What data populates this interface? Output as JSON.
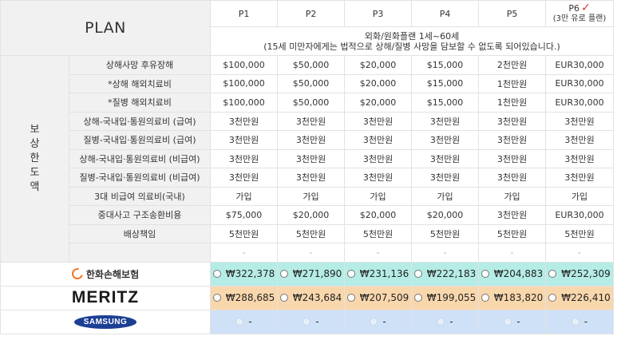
{
  "header": {
    "plan_label": "PLAN",
    "plans": [
      "P1",
      "P2",
      "P3",
      "P4",
      "P5",
      "P6"
    ],
    "p6_note": "(3만 유로 플랜)",
    "subheader_line1": "외화/원화플랜 1세~60세",
    "subheader_line2": "(15세 미만자에게는 법적으로 상해/질병 사망을 담보할 수 없도록 되어있습니다.)"
  },
  "coverage": {
    "label": "보\n상\n한\n도\n액",
    "rows": [
      {
        "name": "상해사망 후유장해",
        "values": [
          "$100,000",
          "$50,000",
          "$20,000",
          "$15,000",
          "2천만원",
          "EUR30,000"
        ]
      },
      {
        "name": "*상해 해외치료비",
        "values": [
          "$100,000",
          "$50,000",
          "$20,000",
          "$15,000",
          "1천만원",
          "EUR30,000"
        ]
      },
      {
        "name": "*질병 해외치료비",
        "values": [
          "$100,000",
          "$50,000",
          "$20,000",
          "$15,000",
          "1천만원",
          "EUR30,000"
        ]
      },
      {
        "name": "상해-국내입·통원의료비 (급여)",
        "values": [
          "3천만원",
          "3천만원",
          "3천만원",
          "3천만원",
          "3천만원",
          "3천만원"
        ]
      },
      {
        "name": "질병-국내입·통원의료비 (급여)",
        "values": [
          "3천만원",
          "3천만원",
          "3천만원",
          "3천만원",
          "3천만원",
          "3천만원"
        ]
      },
      {
        "name": "상해-국내입·통원의료비 (비급여)",
        "values": [
          "3천만원",
          "3천만원",
          "3천만원",
          "3천만원",
          "3천만원",
          "3천만원"
        ]
      },
      {
        "name": "질병-국내입·통원의료비 (비급여)",
        "values": [
          "3천만원",
          "3천만원",
          "3천만원",
          "3천만원",
          "3천만원",
          "3천만원"
        ]
      },
      {
        "name": "3대 비급여 의료비(국내)",
        "values": [
          "가입",
          "가입",
          "가입",
          "가입",
          "가입",
          "가입"
        ]
      },
      {
        "name": "중대사고 구조송환비용",
        "values": [
          "$75,000",
          "$20,000",
          "$20,000",
          "$20,000",
          "3천만원",
          "EUR30,000"
        ]
      },
      {
        "name": "배상책임",
        "values": [
          "5천만원",
          "5천만원",
          "5천만원",
          "5천만원",
          "5천만원",
          "5천만원"
        ]
      },
      {
        "name": "",
        "values": [
          "-",
          "-",
          "-",
          "-",
          "-",
          "-"
        ]
      }
    ]
  },
  "insurers": [
    {
      "name": "한화손해보험",
      "prices": [
        "₩322,378",
        "₩271,890",
        "₩231,136",
        "₩222,183",
        "₩204,883",
        "₩252,309"
      ],
      "color": "#b5ece6"
    },
    {
      "name": "MERITZ",
      "prices": [
        "₩288,685",
        "₩243,684",
        "₩207,509",
        "₩199,055",
        "₩183,820",
        "₩226,410"
      ],
      "color": "#f9d7ad"
    },
    {
      "name": "SAMSUNG",
      "prices": [
        "-",
        "-",
        "-",
        "-",
        "-",
        "-"
      ],
      "color": "#cfe1f7"
    }
  ]
}
